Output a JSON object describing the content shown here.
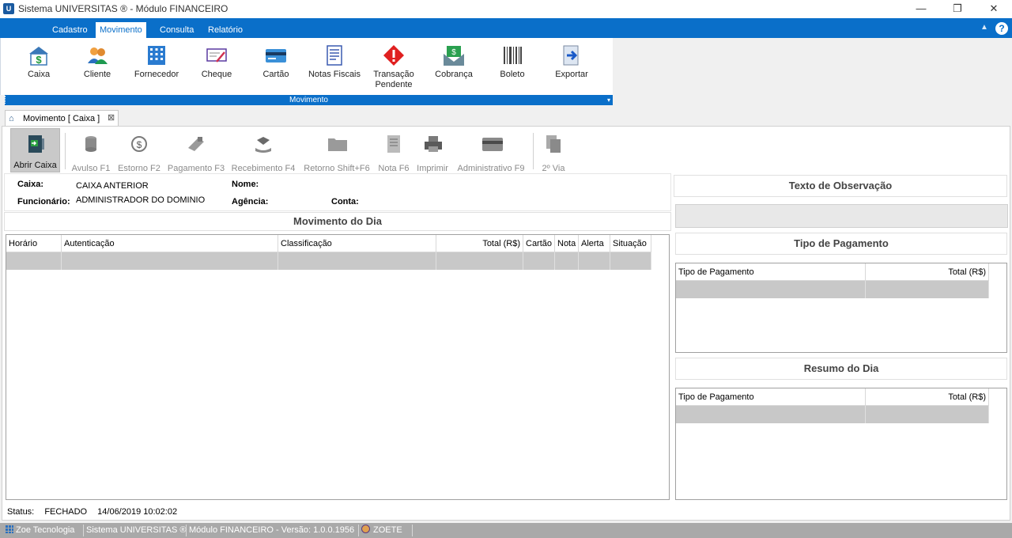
{
  "window": {
    "icon_text": "U",
    "title": "Sistema UNIVERSITAS ® - Módulo FINANCEIRO",
    "minimize": "—",
    "restore": "❐",
    "close": "✕"
  },
  "menu": {
    "tabs": [
      "Cadastro",
      "Movimento",
      "Consulta",
      "Relatório"
    ],
    "active": "Movimento",
    "collapse_icon": "▲",
    "help": "?"
  },
  "ribbon": {
    "buttons": [
      {
        "label": "Caixa",
        "icon": "cash-register-icon"
      },
      {
        "label": "Cliente",
        "icon": "users-icon"
      },
      {
        "label": "Fornecedor",
        "icon": "building-icon"
      },
      {
        "label": "Cheque",
        "icon": "check-icon"
      },
      {
        "label": "Cartão",
        "icon": "card-icon"
      },
      {
        "label": "Notas Fiscais",
        "icon": "invoice-icon"
      },
      {
        "label": "Transação Pendente",
        "icon": "warning-icon"
      },
      {
        "label": "Cobrança",
        "icon": "money-envelope-icon"
      },
      {
        "label": "Boleto",
        "icon": "barcode-icon"
      },
      {
        "label": "Exportar",
        "icon": "export-icon"
      }
    ],
    "group_label": "Movimento",
    "group_arrow": "▾"
  },
  "doc_tab": {
    "label": "Movimento [ Caixa ]",
    "close": "⊠"
  },
  "toolbar": {
    "buttons": [
      {
        "label": "Abrir Caixa",
        "enabled": true
      },
      {
        "label": "Avulso F1",
        "enabled": false
      },
      {
        "label": "Estorno F2",
        "enabled": false
      },
      {
        "label": "Pagamento F3",
        "enabled": false
      },
      {
        "label": "Recebimento F4",
        "enabled": false
      },
      {
        "label": "Retorno Shift+F6",
        "enabled": false
      },
      {
        "label": "Nota F6",
        "enabled": false
      },
      {
        "label": "Imprimir",
        "enabled": false
      },
      {
        "label": "Administrativo F9",
        "enabled": false
      },
      {
        "label": "2º Via",
        "enabled": false
      }
    ]
  },
  "info": {
    "caixa_label": "Caixa:",
    "caixa_value": "CAIXA ANTERIOR",
    "funcionario_label": "Funcionário:",
    "funcionario_value": "ADMINISTRADOR DO DOMINIO",
    "nome_label": "Nome:",
    "agencia_label": "Agência:",
    "conta_label": "Conta:"
  },
  "movimento": {
    "title": "Movimento do Dia",
    "columns": [
      "Horário",
      "Autenticação",
      "Classificação",
      "Total (R$)",
      "Cartão",
      "Nota",
      "Alerta",
      "Situação"
    ]
  },
  "observacao": {
    "title": "Texto de Observação"
  },
  "tipo_pagamento": {
    "title": "Tipo de Pagamento",
    "columns": [
      "Tipo de Pagamento",
      "Total (R$)"
    ]
  },
  "resumo": {
    "title": "Resumo do Dia",
    "columns": [
      "Tipo de Pagamento",
      "Total (R$)"
    ]
  },
  "status": {
    "label": "Status:",
    "state": "FECHADO",
    "datetime": "14/06/2019 10:02:02"
  },
  "bottom_bar": {
    "company": "Zoe Tecnologia",
    "system": "Sistema UNIVERSITAS ®",
    "module_version": "Módulo FINANCEIRO - Versão: 1.0.0.1956",
    "user": "ZOETE"
  },
  "colors": {
    "accent": "#0a6fc9",
    "selected_row": "#c8c8c8",
    "status_bar": "#a9a9a9"
  }
}
